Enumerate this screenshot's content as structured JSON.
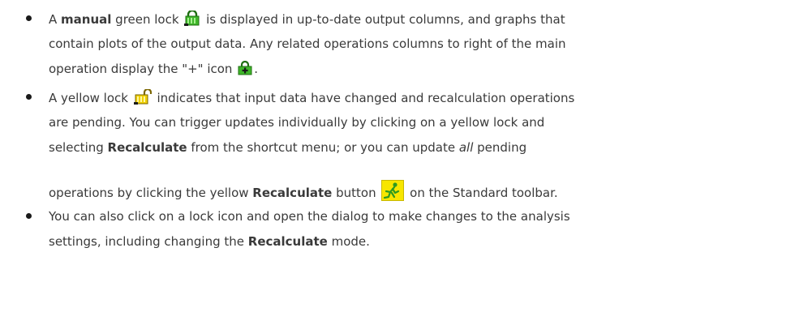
{
  "icons": {
    "green_lock": "green-lock-icon",
    "green_plus_lock": "green-plus-lock-icon",
    "yellow_lock": "yellow-lock-icon",
    "recalculate_button": "recalculate-runner-icon"
  },
  "colors": {
    "green_lock": "#3fb62a",
    "yellow_lock": "#f0d000",
    "recalc_bg": "#f7e600",
    "text": "#3a3a3a"
  },
  "bullets": [
    {
      "l1": {
        "a": "A ",
        "b": "manual",
        "c": " green lock ",
        "d": " is displayed in up-to-date output columns, and graphs that"
      },
      "l2": "contain plots of the output data. Any related operations columns to right of the main",
      "l3": {
        "a": "operation display the \"+\" icon ",
        "b": "."
      }
    },
    {
      "l1": {
        "a": "A yellow lock ",
        "b": " indicates that input data have changed and recalculation operations"
      },
      "l2": "are pending. You can trigger updates individually by clicking on a yellow lock and",
      "l3": {
        "a": "selecting ",
        "b": "Recalculate",
        "c": " from the shortcut menu; or you can update ",
        "d": "all",
        "e": " pending"
      },
      "l4": {
        "a": "operations by clicking the yellow ",
        "b": "Recalculate",
        "c": " button ",
        "d": " on the Standard toolbar."
      }
    },
    {
      "l1": "You can also click on a lock icon and open the dialog to make changes to the analysis",
      "l2": {
        "a": "settings, including changing the ",
        "b": "Recalculate",
        "c": " mode."
      }
    }
  ]
}
